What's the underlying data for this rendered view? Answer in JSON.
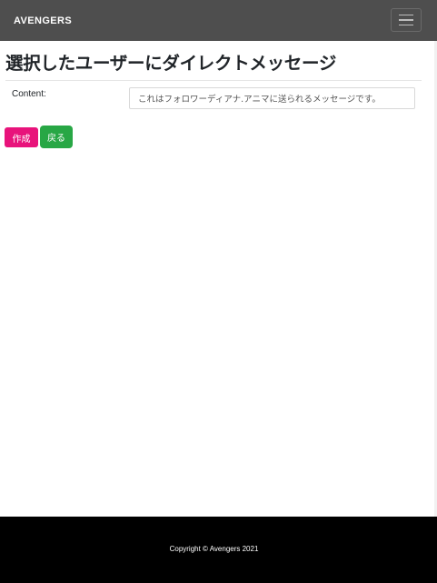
{
  "navbar": {
    "brand": "AVENGERS",
    "toggle_icon": "hamburger-menu-icon"
  },
  "main": {
    "title": "選択したユーザーにダイレクトメッセージ",
    "content_label": "Content:",
    "content_value": "これはフォロワーディアナ.アニマに送られるメッセージです。"
  },
  "actions": {
    "create_label": "作成",
    "back_label": "戻る"
  },
  "footer": {
    "copyright": "Copyright © Avengers 2021"
  },
  "colors": {
    "navbar_bg": "#4e4e4e",
    "create_button": "#e8137b",
    "back_button": "#28a745",
    "footer_bg": "#000000"
  }
}
